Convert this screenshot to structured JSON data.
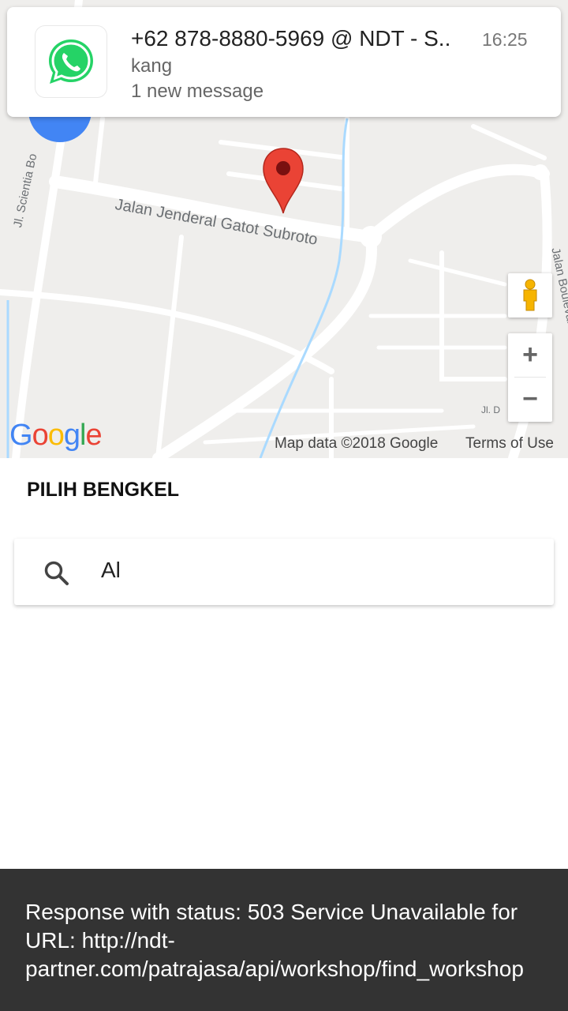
{
  "notification": {
    "app_icon": "whatsapp-icon",
    "title": "+62 878-8880-5969 @ NDT - S..",
    "time": "16:25",
    "sender": "kang",
    "message": "1 new message"
  },
  "map": {
    "road_labels": {
      "gatot_subroto": "Jalan Jenderal Gatot Subroto",
      "scientia": "Jl. Scientia Bo",
      "boulevard": "Jalan Boulevard",
      "jl_d": "Jl. D"
    },
    "logo": "Google",
    "map_data": "Map data ©2018 Google",
    "terms": "Terms of Use",
    "zoom_in": "+",
    "zoom_out": "−",
    "pin_color": "#ea4335",
    "water_color": "#aadaff"
  },
  "sheet": {
    "title": "PILIH BENGKEL",
    "search_value": "Al",
    "search_icon": "search-icon"
  },
  "toast": {
    "text": "Response with status: 503 Service Unavailable for\nURL: http://ndt-\npartner.com/patrajasa/api/workshop/find_workshop"
  },
  "colors": {
    "fab": "#4285f4",
    "toast_bg": "#333333"
  }
}
